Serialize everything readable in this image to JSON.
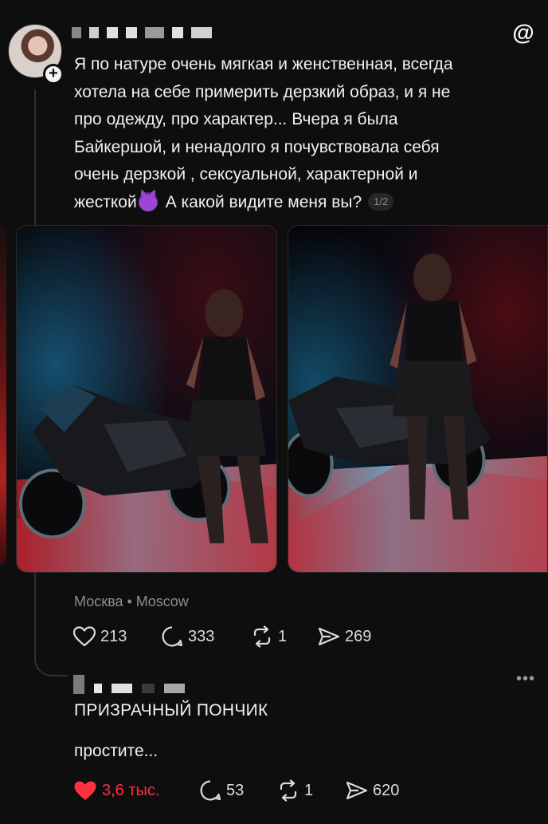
{
  "post": {
    "text_line1": "Я по натуре очень мягкая и женственная, всегда",
    "text_line2": "хотела на себе примерить дерзкий образ, и я не",
    "text_line3": "про одежду, про характер... Вчера я была",
    "text_line4": "Байкершой, и ненадолго я почувствовала себя",
    "text_line5": "очень дерзкой , сексуальной, характерной и",
    "text_line6a": "жесткой",
    "text_line6b": "А какой видите меня вы?",
    "page_counter": "1/2",
    "location": "Москва • Moscow",
    "stats": {
      "likes": "213",
      "comments": "333",
      "reposts": "1",
      "shares": "269"
    }
  },
  "reply": {
    "name": "ПРИЗРАЧНЫЙ ПОНЧИК",
    "body": "простите...",
    "stats": {
      "likes": "3,6 тыс.",
      "comments": "53",
      "reposts": "1",
      "shares": "620"
    }
  },
  "colors": {
    "background": "#0e0e0e",
    "liked": "#ff3040",
    "muted": "#8d8d8d"
  },
  "icons": [
    "threads-logo-icon",
    "heart-icon",
    "comment-icon",
    "repost-icon",
    "share-icon",
    "more-icon",
    "plus-icon",
    "devil-emoji-icon"
  ]
}
